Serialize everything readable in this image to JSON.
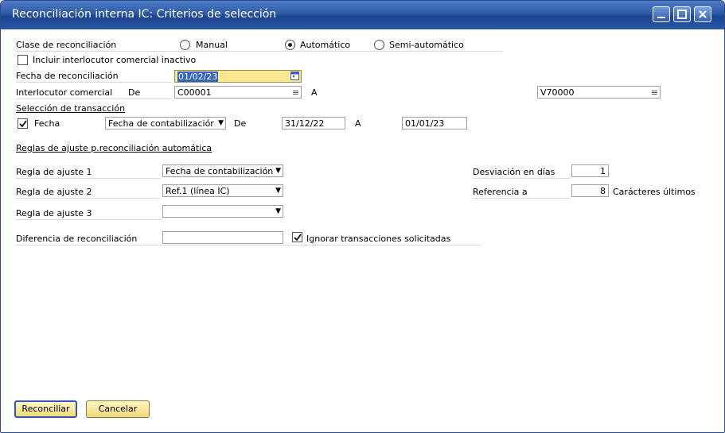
{
  "window": {
    "title": "Reconciliación interna IC: Criterios de selección"
  },
  "reconciliation_type": {
    "label": "Clase de reconciliación",
    "options": [
      "Manual",
      "Automático",
      "Semi-automático"
    ],
    "selected": "Automático"
  },
  "include_inactive": {
    "label": "Incluir interlocutor comercial inactivo",
    "checked": false
  },
  "reconciliation_date": {
    "label": "Fecha de reconciliación",
    "value": "01/02/23"
  },
  "business_partner": {
    "label": "Interlocutor comercial",
    "from_label": "De",
    "from_value": "C00001",
    "to_label": "A",
    "to_value": "V70000"
  },
  "transaction_selection": {
    "heading": "Selección de transacción",
    "date_label": "Fecha",
    "date_checked": true,
    "date_type": "Fecha de contabilizaciór",
    "from_label": "De",
    "from_value": "31/12/22",
    "to_label": "A",
    "to_value": "01/01/23"
  },
  "adjust_rules": {
    "heading": "Reglas de ajuste p.reconciliación automática",
    "rule1_label": "Regla de ajuste 1",
    "rule1_value": "Fecha de contabilización",
    "rule2_label": "Regla de ajuste 2",
    "rule2_value": "Ref.1 (línea IC)",
    "rule3_label": "Regla de ajuste 3",
    "rule3_value": "",
    "deviation_label": "Desviación en días",
    "deviation_value": "1",
    "reference_label": "Referencia a",
    "reference_value": "8",
    "reference_suffix": "Carácteres últimos"
  },
  "difference": {
    "label": "Diferencia de reconciliación",
    "value": "",
    "ignore_label": "Ignorar transacciones solicitadas",
    "ignore_checked": true
  },
  "buttons": {
    "reconcile": "Reconciliar",
    "cancel": "Cancelar"
  },
  "colors": {
    "titlebar": "#2d5aa8",
    "active_field": "#fde891",
    "button": "#f3d97a"
  }
}
